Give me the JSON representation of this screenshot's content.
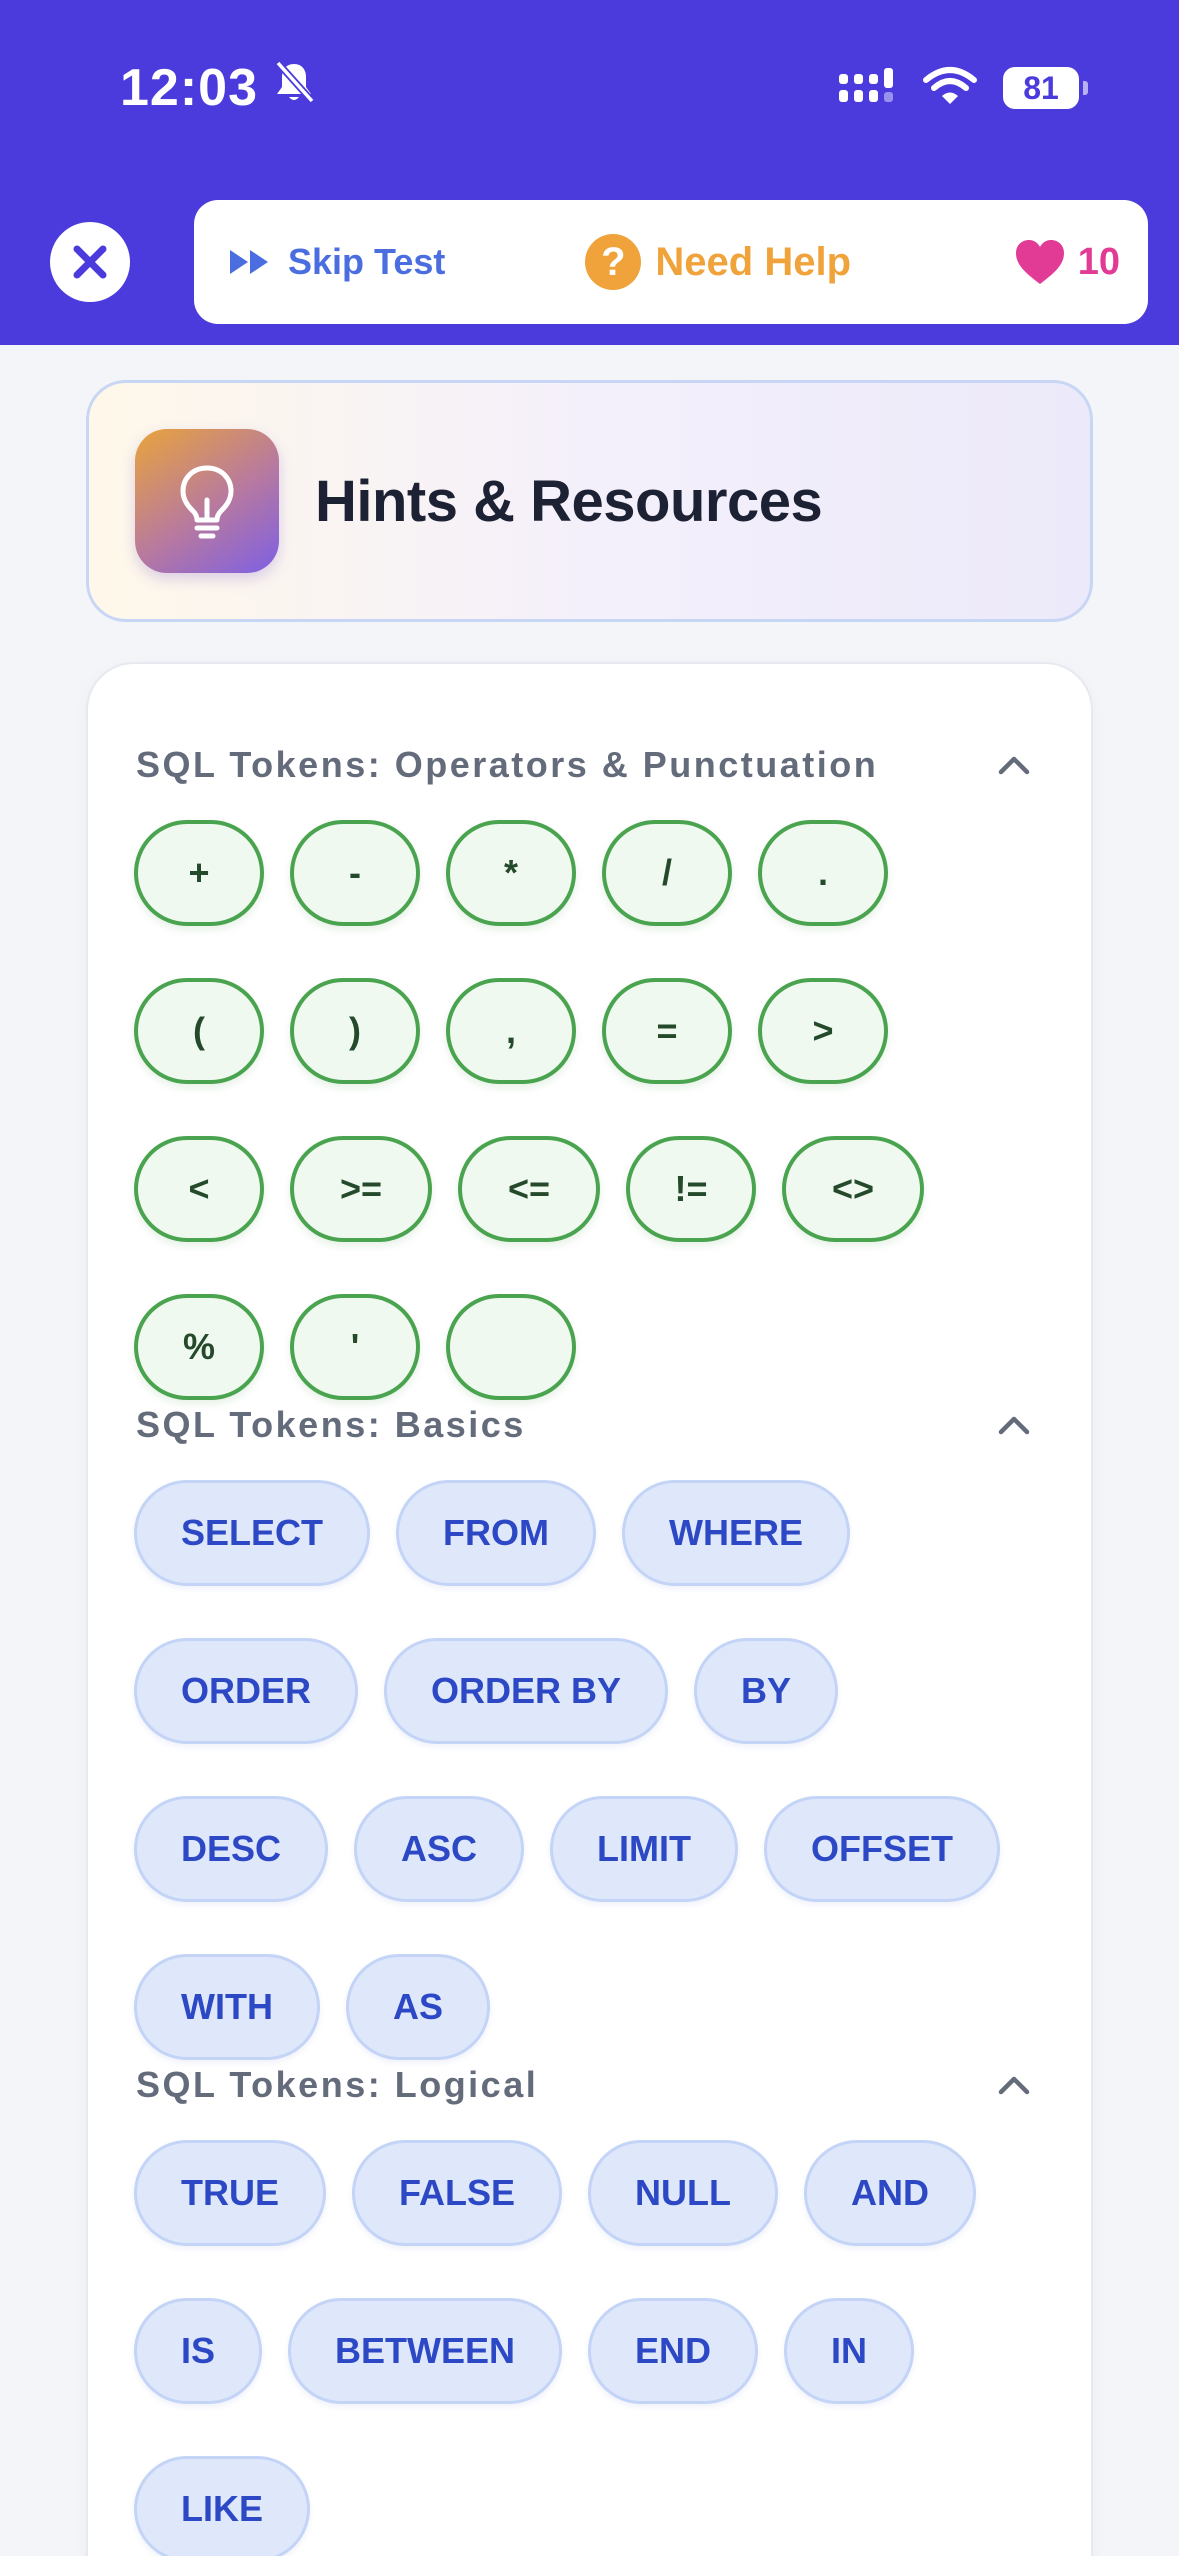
{
  "status_bar": {
    "time": "12:03",
    "battery": "81",
    "icons": [
      "bell-slash-icon",
      "signal-icon",
      "wifi-icon",
      "battery-icon"
    ]
  },
  "toolbar": {
    "skip_label": "Skip Test",
    "help_label": "Need Help",
    "help_glyph": "?",
    "lives_count": "10",
    "colors": {
      "header_bg": "#4b3bdc",
      "skip": "#4a6ee0",
      "help": "#f0a33a",
      "lives": "#e23b95"
    }
  },
  "hints": {
    "title": "Hints & Resources"
  },
  "sections": [
    {
      "title": "SQL Tokens: Operators & Punctuation",
      "style": "operator",
      "tokens": [
        "+",
        "-",
        "*",
        "/",
        ".",
        "(",
        ")",
        ",",
        "=",
        ">",
        "<",
        ">=",
        "<=",
        "!=",
        "<>",
        "%",
        "'",
        " "
      ]
    },
    {
      "title": "SQL Tokens: Basics",
      "style": "keyword",
      "tokens": [
        "SELECT",
        "FROM",
        "WHERE",
        "ORDER",
        "ORDER BY",
        "BY",
        "DESC",
        "ASC",
        "LIMIT",
        "OFFSET",
        "WITH",
        "AS"
      ]
    },
    {
      "title": "SQL Tokens: Logical",
      "style": "keyword",
      "tokens": [
        "TRUE",
        "FALSE",
        "NULL",
        "AND",
        "IS",
        "BETWEEN",
        "END",
        "IN",
        "LIKE"
      ]
    }
  ]
}
